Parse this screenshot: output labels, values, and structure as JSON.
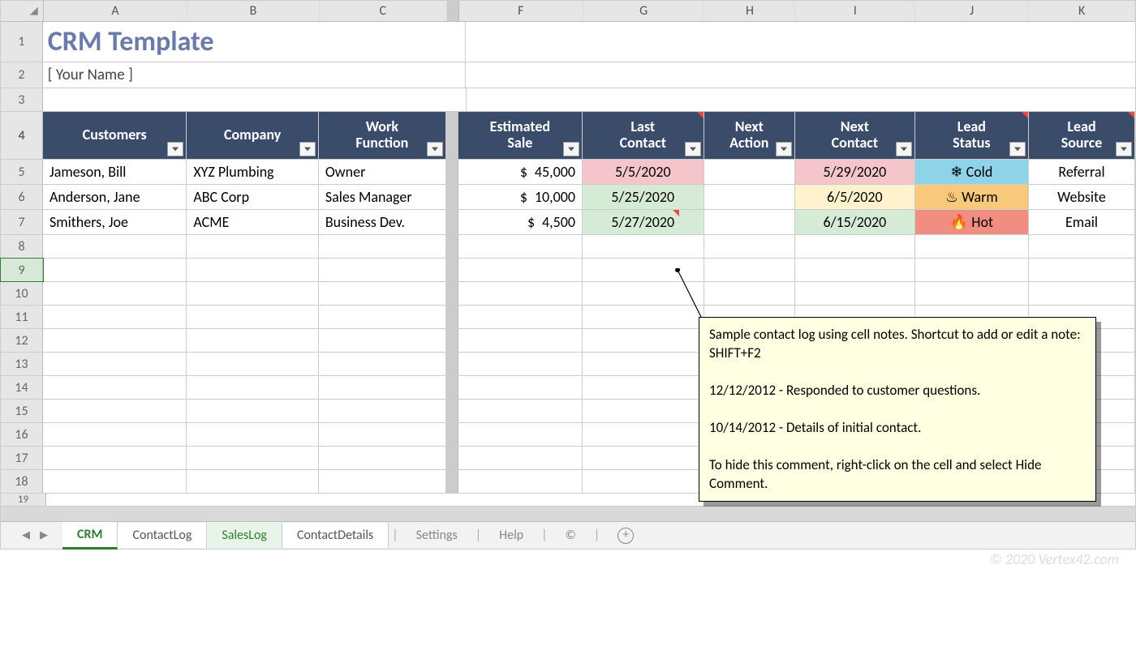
{
  "title": "CRM Template",
  "subtitle": "[ Your Name ]",
  "watermark": "© 2020 Vertex42.com",
  "columns": [
    "A",
    "B",
    "C",
    "F",
    "G",
    "H",
    "I",
    "J",
    "K"
  ],
  "headers": {
    "customers": "Customers",
    "company": "Company",
    "work_function_l1": "Work",
    "work_function_l2": "Function",
    "est_sale_l1": "Estimated",
    "est_sale_l2": "Sale",
    "last_contact_l1": "Last",
    "last_contact_l2": "Contact",
    "next_action_l1": "Next",
    "next_action_l2": "Action",
    "next_contact_l1": "Next",
    "next_contact_l2": "Contact",
    "lead_status_l1": "Lead",
    "lead_status_l2": "Status",
    "lead_source_l1": "Lead",
    "lead_source_l2": "Source"
  },
  "rows": [
    {
      "num": 5,
      "customer": "Jameson, Bill",
      "company": "XYZ Plumbing",
      "func": "Owner",
      "sale": "45,000",
      "last": "5/5/2020",
      "lastcls": "bg-pink",
      "next_action": "",
      "next_contact": "5/29/2020",
      "nextcls": "bg-pink",
      "lead": "Cold",
      "leadcls": "lead-cold",
      "leadicon": "❄",
      "source": "Referral"
    },
    {
      "num": 6,
      "customer": "Anderson, Jane",
      "company": "ABC Corp",
      "func": "Sales Manager",
      "sale": "10,000",
      "last": "5/25/2020",
      "lastcls": "bg-lgreen",
      "next_action": "",
      "next_contact": "6/5/2020",
      "nextcls": "bg-lyellow",
      "lead": "Warm",
      "leadcls": "lead-warm",
      "leadicon": "♨",
      "source": "Website"
    },
    {
      "num": 7,
      "customer": "Smithers, Joe",
      "company": "ACME",
      "func": "Business Dev.",
      "sale": "4,500",
      "last": "5/27/2020",
      "lastcls": "bg-mgreen",
      "next_action": "",
      "next_contact": "6/15/2020",
      "nextcls": "bg-mgreen",
      "lead": "Hot",
      "leadcls": "lead-hot",
      "leadicon": "🔥",
      "source": "Email"
    }
  ],
  "comment": {
    "p1": "Sample contact log using cell notes. Shortcut to add or edit a note: SHIFT+F2",
    "p2": "12/12/2012 - Responded to customer questions.",
    "p3": "10/14/2012 - Details of initial contact.",
    "p4": "To hide this comment, right-click on the cell and select Hide Comment."
  },
  "tabs": {
    "crm": "CRM",
    "contactlog": "ContactLog",
    "saleslog": "SalesLog",
    "contactdetails": "ContactDetails",
    "settings": "Settings",
    "help": "Help",
    "copyright": "©"
  }
}
